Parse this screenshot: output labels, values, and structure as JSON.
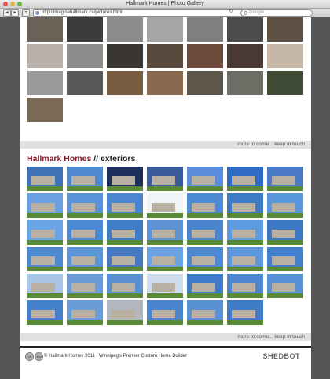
{
  "window": {
    "title": "Hallmark Homes | Photo Gallery"
  },
  "toolbar": {
    "back": "◂",
    "forward": "▸",
    "add": "+",
    "url": "http://imaginehallmark.ca/pictures.html",
    "reload": "↻",
    "search_placeholder": "Google"
  },
  "interiors": {
    "more_text": "more to come... keep in touch"
  },
  "exteriors": {
    "brand": "Hallmark Homes",
    "separator": " // ",
    "label": "exteriors",
    "more_text": "more to come... keep in touch"
  },
  "footer": {
    "copyright": "© Hallmark Homes 2011 | Winnipeg's Premier Custom Home Builder",
    "badge_1": "MB",
    "badge_2": "HBA",
    "logo": "SHEDBOT"
  },
  "colors": {
    "brand": "#8a1c2a",
    "bar_bg": "#e0e0e0",
    "page_bg": "#555555"
  }
}
